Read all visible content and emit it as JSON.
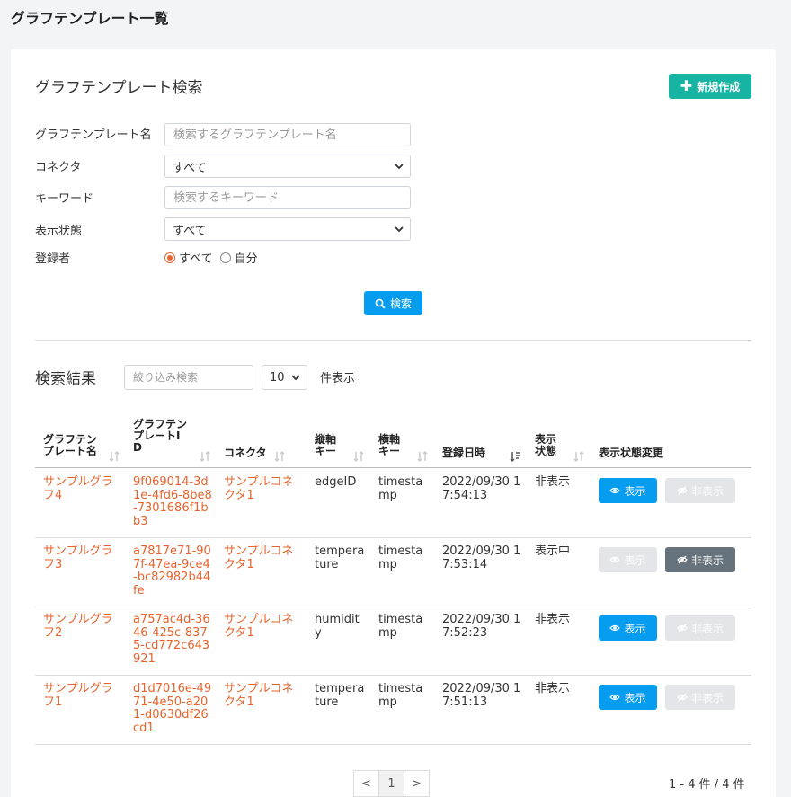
{
  "page_title": "グラフテンプレート一覧",
  "search": {
    "title": "グラフテンプレート検索",
    "new_button": "新規作成",
    "template_name_label": "グラフテンプレート名",
    "template_name_placeholder": "検索するグラフテンプレート名",
    "connector_label": "コネクタ",
    "connector_value": "すべて",
    "keyword_label": "キーワード",
    "keyword_placeholder": "検索するキーワード",
    "display_state_label": "表示状態",
    "display_state_value": "すべて",
    "registrant_label": "登録者",
    "registrant_all": "すべて",
    "registrant_self": "自分",
    "search_button": "検索"
  },
  "results": {
    "title": "検索結果",
    "filter_placeholder": "絞り込み検索",
    "per_page_value": "10",
    "per_page_label": "件表示",
    "columns": [
      "グラフテン\nプレート名",
      "グラフテン\nプレートI\nD",
      "コネクタ",
      "縦軸\nキー",
      "横軸\nキー",
      "登録日時",
      "表示\n状態",
      "表示状態変更"
    ],
    "rows": [
      {
        "name": "サンプルグラフ4",
        "id": "9f069014-3d1e-4fd6-8be8-7301686f1bb3",
        "connector": "サンプルコネクタ1",
        "y_key": "edgeID",
        "x_key": "timestamp",
        "date": "2022/09/30 17:54:13",
        "status": "非表示",
        "show_label": "表示",
        "hide_label": "非表示",
        "show_enabled": true,
        "hide_enabled": false
      },
      {
        "name": "サンプルグラフ3",
        "id": "a7817e71-907f-47ea-9ce4-bc82982b44fe",
        "connector": "サンプルコネクタ1",
        "y_key": "temperature",
        "x_key": "timestamp",
        "date": "2022/09/30 17:53:14",
        "status": "表示中",
        "show_label": "表示",
        "hide_label": "非表示",
        "show_enabled": false,
        "hide_enabled": true
      },
      {
        "name": "サンプルグラフ2",
        "id": "a757ac4d-3646-425c-8375-cd772c643921",
        "connector": "サンプルコネクタ1",
        "y_key": "humidity",
        "x_key": "timestamp",
        "date": "2022/09/30 17:52:23",
        "status": "非表示",
        "show_label": "表示",
        "hide_label": "非表示",
        "show_enabled": true,
        "hide_enabled": false
      },
      {
        "name": "サンプルグラフ1",
        "id": "d1d7016e-4971-4e50-a201-d0630df26cd1",
        "connector": "サンプルコネクタ1",
        "y_key": "temperature",
        "x_key": "timestamp",
        "date": "2022/09/30 17:51:13",
        "status": "非表示",
        "show_label": "表示",
        "hide_label": "非表示",
        "show_enabled": true,
        "hide_enabled": false
      }
    ]
  },
  "pagination": {
    "prev": "<",
    "current": "1",
    "next": ">",
    "summary": "1 - 4 件 / 4 件"
  },
  "colors": {
    "accent_teal": "#17b3a3",
    "primary_blue": "#069df1",
    "link_orange": "#e8632c",
    "secondary_gray": "#66727c",
    "disabled_gray": "#e3e5e8"
  }
}
